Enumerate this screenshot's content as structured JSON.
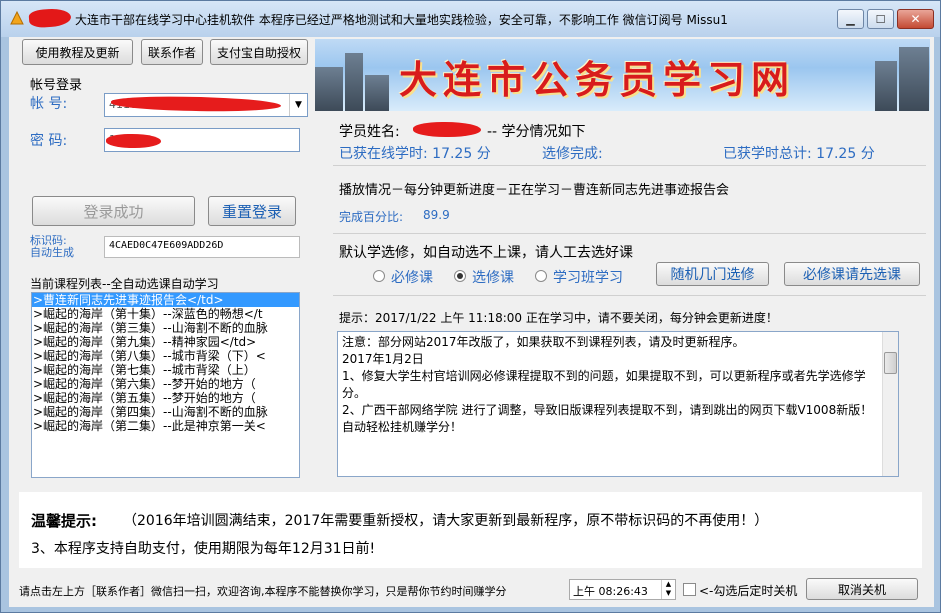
{
  "title": {
    "text": "大连市干部在线学习中心挂机软件  本程序已经过严格地测试和大量地实践检验，安全可靠，不影响工作 微信订阅号 Missu1"
  },
  "toolbar": {
    "tutorial": "使用教程及更新",
    "contact": "联系作者",
    "alipay": "支付宝自助授权"
  },
  "login": {
    "section": "帐号登录",
    "account_label": "帐  号:",
    "account_value": "                   4110120509",
    "password_label": "密  码:",
    "password_value": "1    ",
    "login_btn": "登录成功",
    "reset_btn": "重置登录",
    "id_label_1": "标识码:",
    "id_label_2": "自动生成",
    "id_value": "4CAED0C47E609ADD26D"
  },
  "courses": {
    "header": "当前课程列表--全自动选课自动学习",
    "items": [
      ">曹连新同志先进事迹报告会</td>",
      ">崛起的海岸（第十集）--深蓝色的畅想</t",
      ">崛起的海岸（第三集）--山海割不断的血脉",
      ">崛起的海岸（第九集）--精神家园</td>",
      ">崛起的海岸（第八集）--城市背梁（下）<",
      ">崛起的海岸（第七集）--城市背梁（上）",
      ">崛起的海岸（第六集）--梦开始的地方（",
      ">崛起的海岸（第五集）--梦开始的地方（",
      ">崛起的海岸（第四集）--山海割不断的血脉",
      ">崛起的海岸（第二集）--此是神京第一关<"
    ]
  },
  "banner": {
    "title": "大连市公务员学习网"
  },
  "student": {
    "name_prefix": "学员姓名:",
    "name_suffix": "-- 学分情况如下",
    "online_hours": "已获在线学时:  17.25 分",
    "elective": "选修完成:",
    "total_hours": "已获学时总计:  17.25 分"
  },
  "playback": {
    "status": "播放情况－每分钟更新进度－正在学习－曹连新同志先进事迹报告会",
    "percent_label": "完成百分比:",
    "percent_value": "89.9"
  },
  "course_type": {
    "heading": "默认学选修，如自动选不上课，请人工去选好课",
    "opt_required": "必修课",
    "opt_elective": "选修课",
    "opt_class": "学习班学习",
    "btn_random": "随机几门选修",
    "btn_required": "必修课请先选课"
  },
  "notice": {
    "tip": "提示：2017/1/22 上午 11:18:00 正在学习中，请不要关闭，每分钟会更新进度！",
    "lines": [
      "注意：部分网站2017年改版了，如果获取不到课程列表，请及时更新程序。",
      "",
      "",
      "2017年1月2日",
      "1、修复大学生村官培训网必修课程提取不到的问题，如果提取不到，可以更新程序或者先学选修学分。",
      "2、广西干部网络学院 进行了调整，导致旧版课程列表提取不到，请到跳出的网页下载V1008新版！自动轻松挂机赚学分！"
    ]
  },
  "warm": {
    "label": "温馨提示:",
    "line1": "（2016年培训圆满结束，2017年需要重新授权，请大家更新到最新程序，原不带标识码的不再使用！）",
    "line2": "3、本程序支持自助支付，使用期限为每年12月31日前!"
  },
  "footer": {
    "hint": "请点击左上方［联系作者］微信扫一扫，欢迎咨询,本程序不能替换你学习，只是帮你节约时间赚学分",
    "time": "上午 08:26:43",
    "timer_check": "<-勾选后定时关机",
    "cancel_btn": "取消关机"
  }
}
